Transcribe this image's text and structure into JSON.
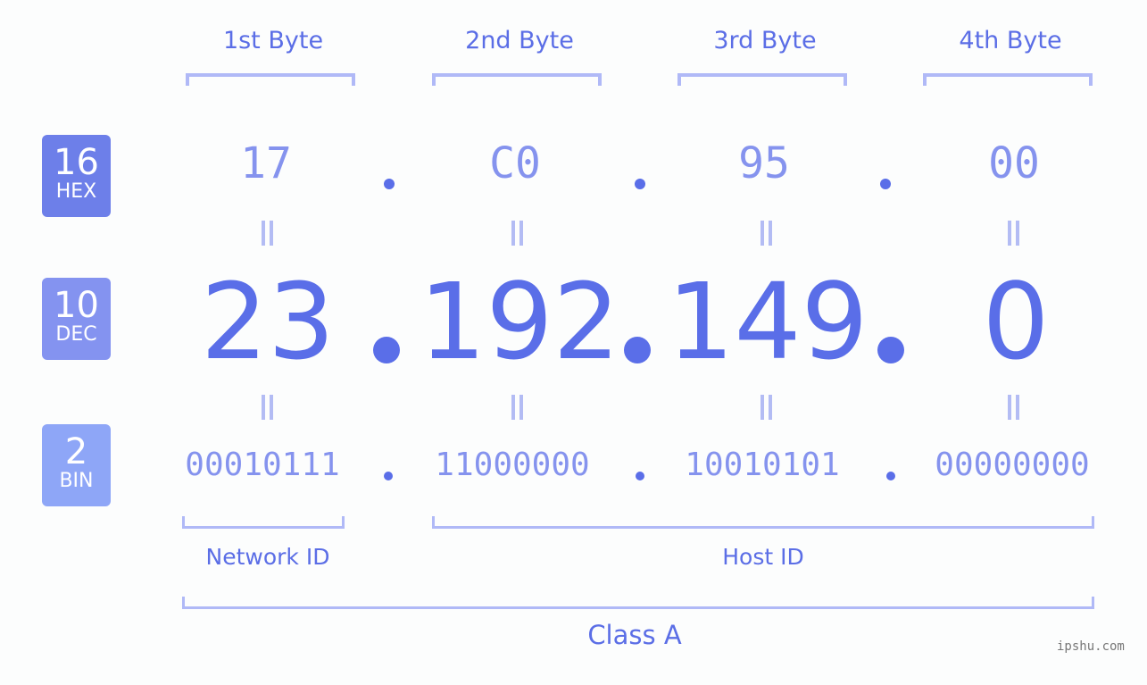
{
  "byte_headers": [
    "1st Byte",
    "2nd Byte",
    "3rd Byte",
    "4th Byte"
  ],
  "badges": {
    "hex": {
      "number": "16",
      "label": "HEX",
      "color": "#6d7fe9"
    },
    "dec": {
      "number": "10",
      "label": "DEC",
      "color": "#8493f0"
    },
    "bin": {
      "number": "2",
      "label": "BIN",
      "color": "#8ea6f7"
    }
  },
  "hex_values": [
    "17",
    "C0",
    "95",
    "00"
  ],
  "dec_values": [
    "23",
    "192",
    "149",
    "0"
  ],
  "bin_values": [
    "00010111",
    "11000000",
    "10010101",
    "00000000"
  ],
  "separator": ".",
  "groups": {
    "network_id": "Network ID",
    "host_id": "Host ID",
    "class": "Class A"
  },
  "watermark": "ipshu.com",
  "colors": {
    "accent": "#5a6ee8",
    "light": "#8593ee",
    "bracket": "#b0b9f7"
  }
}
